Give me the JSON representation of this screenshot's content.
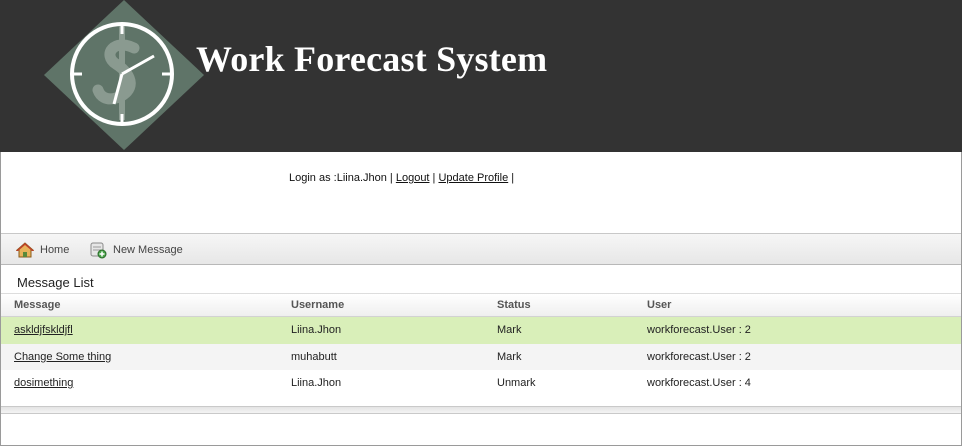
{
  "header": {
    "title": "Work Forecast System"
  },
  "login": {
    "prefix": "Login as :Liina.Jhon",
    "sep1": " | ",
    "logout": "Logout",
    "sep2": " | ",
    "update_profile": "Update Profile",
    "sep3": " |"
  },
  "toolbar": {
    "home": "Home",
    "new_message": "New Message"
  },
  "section_title": "Message List",
  "table": {
    "headers": [
      "Message",
      "Username",
      "Status",
      "User"
    ],
    "rows": [
      {
        "message": "askldjfskldjfl",
        "username": "Liina.Jhon",
        "status": "Mark",
        "user": "workforecast.User : 2"
      },
      {
        "message": "Change Some thing",
        "username": "muhabutt",
        "status": "Mark",
        "user": "workforecast.User : 2"
      },
      {
        "message": "dosimething",
        "username": "Liina.Jhon",
        "status": "Unmark",
        "user": "workforecast.User : 4"
      }
    ]
  },
  "colors": {
    "header_bg": "#333333",
    "selected_row": "#d9efb9",
    "logo_diamond": "#5f7468"
  }
}
